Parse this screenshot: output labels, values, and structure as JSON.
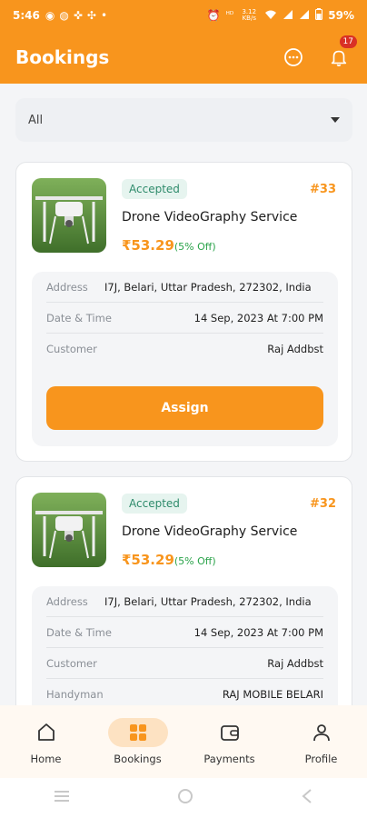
{
  "status_bar": {
    "time": "5:46",
    "network_speed": "3.12 KB/s",
    "battery": "59%"
  },
  "header": {
    "title": "Bookings",
    "notification_count": "17"
  },
  "filter": {
    "selected": "All"
  },
  "bookings": [
    {
      "status": "Accepted",
      "id": "#33",
      "service": "Drone VideoGraphy Service",
      "price": "₹53.29",
      "discount": "(5% Off)",
      "details": [
        {
          "label": "Address",
          "value": "I7J, Belari, Uttar Pradesh, 272302, India"
        },
        {
          "label": "Date & Time",
          "value": "14 Sep, 2023 At 7:00 PM"
        },
        {
          "label": "Customer",
          "value": "Raj Addbst"
        }
      ],
      "action": "Assign"
    },
    {
      "status": "Accepted",
      "id": "#32",
      "service": "Drone VideoGraphy Service",
      "price": "₹53.29",
      "discount": "(5% Off)",
      "details": [
        {
          "label": "Address",
          "value": "I7J, Belari, Uttar Pradesh, 272302, India"
        },
        {
          "label": "Date & Time",
          "value": "14 Sep, 2023 At 7:00 PM"
        },
        {
          "label": "Customer",
          "value": "Raj Addbst"
        },
        {
          "label": "Handyman",
          "value": "RAJ MOBILE BELARI"
        }
      ]
    }
  ],
  "bottom_nav": [
    {
      "label": "Home",
      "icon": "home-icon"
    },
    {
      "label": "Bookings",
      "icon": "bookings-icon",
      "active": true
    },
    {
      "label": "Payments",
      "icon": "wallet-icon"
    },
    {
      "label": "Profile",
      "icon": "profile-icon"
    }
  ],
  "colors": {
    "accent": "#f8951d",
    "status_bg": "#e6f4ef",
    "status_text": "#2e8b6b",
    "discount": "#2aa34a",
    "badge": "#d93025"
  }
}
